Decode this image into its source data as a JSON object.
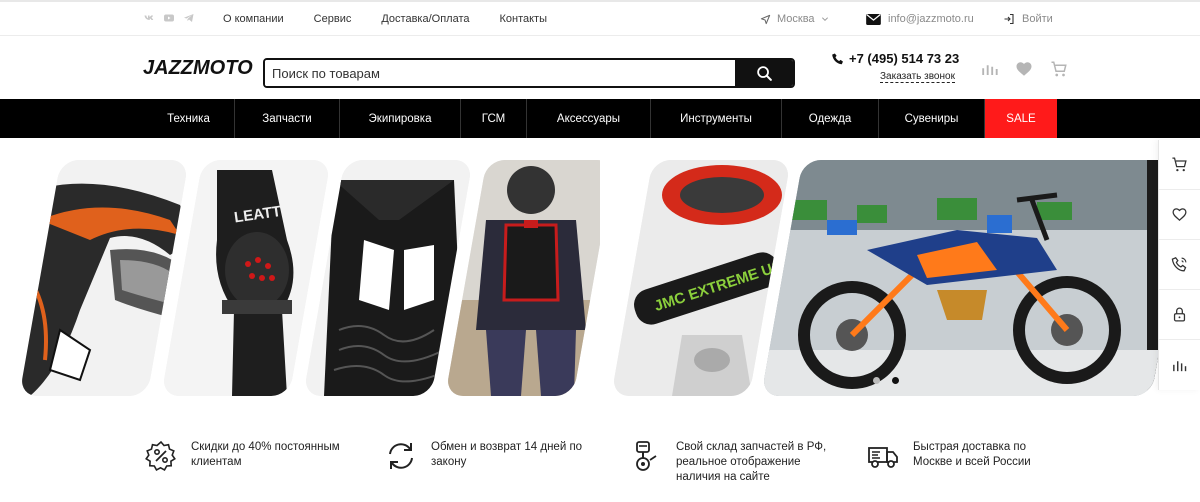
{
  "topbar": {
    "social": [
      "vk-icon",
      "youtube-icon",
      "telegram-icon"
    ],
    "links": [
      "О компании",
      "Сервис",
      "Доставка/Оплата",
      "Контакты"
    ],
    "city": "Москва",
    "email": "info@jazzmoto.ru",
    "login": "Войти"
  },
  "header": {
    "logo": "JAZZMOTO",
    "search_placeholder": "Поиск по товарам",
    "phone": "+7 (495) 514 73 23",
    "callback": "Заказать звонок",
    "icons": [
      "compare-icon",
      "heart-icon",
      "cart-icon"
    ]
  },
  "nav": {
    "items": [
      "Техника",
      "Запчасти",
      "Экипировка",
      "ГСМ",
      "Аксессуары",
      "Инструменты",
      "Одежда",
      "Сувениры",
      "SALE"
    ]
  },
  "banners": {
    "left": [
      "helmet",
      "knee-brace",
      "armor-jacket",
      "rider-body-armor"
    ],
    "right": [
      "red-clutch-cover",
      "bar-pad",
      "dirt-bike-showroom"
    ],
    "bar_pad_text": "JMC EXTREME USE ONLY"
  },
  "slider": {
    "count": 2,
    "active": 1
  },
  "sidebar": [
    "cart-icon",
    "heart-icon",
    "phone-icon",
    "lock-icon",
    "compare-icon"
  ],
  "features": [
    {
      "icon": "discount-icon",
      "lines": [
        "Скидки до 40% постоянным",
        "клиентам"
      ]
    },
    {
      "icon": "exchange-icon",
      "lines": [
        "Обмен и возврат 14 дней по",
        "закону"
      ]
    },
    {
      "icon": "warehouse-icon",
      "lines": [
        "Свой склад запчастей в РФ,",
        "реальное отображение",
        "наличия на сайте"
      ]
    },
    {
      "icon": "delivery-truck-icon",
      "lines": [
        "Быстрая доставка по",
        "Москве и всей России"
      ]
    }
  ],
  "colors": {
    "accent_sale": "#ff1a1a",
    "nav_bg": "#000000",
    "text_muted": "#8a8a8a"
  }
}
